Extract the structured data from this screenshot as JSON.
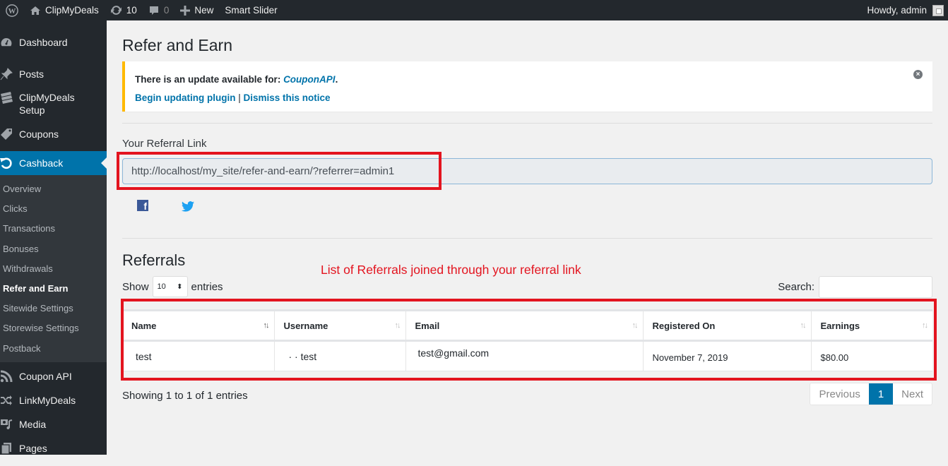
{
  "adminbar": {
    "site_name": "ClipMyDeals",
    "updates_count": "10",
    "comments_count": "0",
    "new_label": "New",
    "smart_slider_label": "Smart Slider",
    "howdy": "Howdy, admin"
  },
  "sidebar": {
    "items": [
      {
        "label": "Dashboard",
        "icon": "dashboard-icon"
      },
      {
        "label": "Posts",
        "icon": "pin-icon"
      },
      {
        "label": "ClipMyDeals Setup",
        "icon": "tickets-icon"
      },
      {
        "label": "Coupons",
        "icon": "tag-icon"
      },
      {
        "label": "Cashback",
        "icon": "undo-icon"
      }
    ],
    "submenu": [
      "Overview",
      "Clicks",
      "Transactions",
      "Bonuses",
      "Withdrawals",
      "Refer and Earn",
      "Sitewide Settings",
      "Storewise Settings",
      "Postback"
    ],
    "bottom_items": [
      {
        "label": "Coupon API",
        "icon": "rss-icon"
      },
      {
        "label": "LinkMyDeals",
        "icon": "shuffle-icon"
      },
      {
        "label": "Media",
        "icon": "media-icon"
      },
      {
        "label": "Pages",
        "icon": "pages-icon"
      }
    ]
  },
  "page": {
    "title": "Refer and Earn",
    "notice": {
      "text": "There is an update available for: ",
      "plugin": "CouponAPI",
      "period": ".",
      "begin_link": "Begin updating plugin",
      "separator": "|",
      "dismiss_link": "Dismiss this notice"
    },
    "referral_label": "Your Referral Link",
    "referral_link": "http://localhost/my_site/refer-and-earn/?referrer=admin1",
    "referrals_title": "Referrals",
    "annotation": "List of Referrals joined through your referral link",
    "show_label": "Show",
    "entries_value": "10",
    "entries_label": "entries",
    "search_label": "Search:",
    "search_value": "",
    "table": {
      "columns": [
        "Name",
        "Username",
        "Email",
        "Registered On",
        "Earnings"
      ],
      "rows": [
        [
          "test",
          "· · test",
          "test@gmail.com",
          "November 7, 2019",
          "$80.00"
        ]
      ]
    },
    "showing_text": "Showing 1 to 1 of 1 entries",
    "pager": {
      "previous": "Previous",
      "current": "1",
      "next": "Next"
    }
  }
}
